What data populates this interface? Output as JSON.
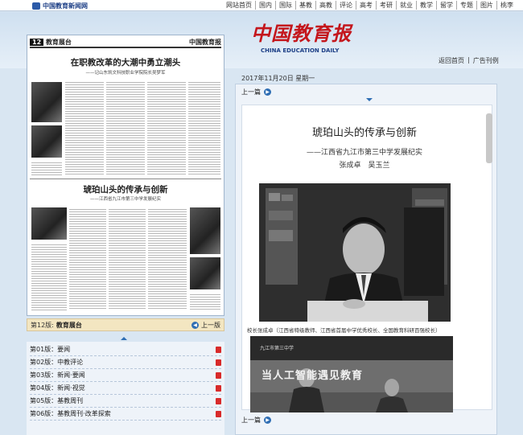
{
  "topbar": {
    "site_name": "中国教育新闻网",
    "nav_items": [
      "网站首页",
      "国内",
      "国际",
      "基教",
      "高教",
      "评论",
      "高考",
      "考研",
      "就业",
      "教学",
      "留学",
      "专题",
      "图片",
      "桃李"
    ]
  },
  "header": {
    "masthead": "中国教育报",
    "masthead_en": "CHINA EDUCATION DAILY",
    "link_home": "返回首页",
    "link_sep": "|",
    "link_ads": "广告刊例",
    "date": "2017年11月20日  星期一"
  },
  "newspaper_preview": {
    "page_no": "12",
    "page_name": "教育展台",
    "paper_name": "中国教育报",
    "headline1": "在职教改革的大潮中勇立潮头",
    "sub1": "——记山东凯文科技职业学院院长吴梦军",
    "headline2": "琥珀山头的传承与创新",
    "sub2": "——江西省九江市第三中学发展纪实"
  },
  "current_page": {
    "page": "第12版:",
    "name": "教育展台",
    "prev_label": "上一版"
  },
  "pages": [
    {
      "label": "第01版：要闻"
    },
    {
      "label": "第02版：中教评论"
    },
    {
      "label": "第03版：新闻·要闻"
    },
    {
      "label": "第04版：新闻·视觉"
    },
    {
      "label": "第05版：基教周刊"
    },
    {
      "label": "第06版：基教周刊·改革探索"
    }
  ],
  "article": {
    "prev_label": "上一篇",
    "title": "琥珀山头的传承与创新",
    "subtitle": "——江西省九江市第三中学发展纪实",
    "authors": "张成卓　吴玉兰",
    "caption1": "校长张成卓（江西省特级教师、江西省首届中学优秀校长、全国教育科研百强校长）",
    "photo2_banner": "当人工智能遇见教育",
    "photo2_logo": "九江市第三中学"
  }
}
